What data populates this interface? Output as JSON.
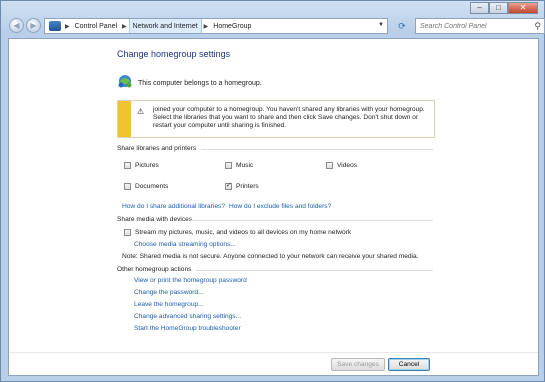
{
  "window": {
    "minimize": "–",
    "maximize": "□",
    "close": "✕"
  },
  "toolbar": {
    "breadcrumbs": [
      "Control Panel",
      "Network and Internet",
      "HomeGroup"
    ],
    "search_placeholder": "Search Control Panel",
    "back_icon": "back-arrow-icon",
    "forward_icon": "forward-arrow-icon"
  },
  "main": {
    "title": "Change homegroup settings",
    "status_text": "This computer belongs to a homegroup.",
    "warning": {
      "text": "joined your computer to a homegroup. You haven't shared any libraries with your homegroup. Select the libraries that you want to share and then click Save changes. Don't shut down or restart your computer until sharing is finished."
    },
    "share_section": {
      "heading": "Share libraries and printers",
      "items": [
        {
          "label": "Pictures",
          "checked": false
        },
        {
          "label": "Music",
          "checked": false
        },
        {
          "label": "Videos",
          "checked": false
        },
        {
          "label": "Documents",
          "checked": false
        },
        {
          "label": "Printers",
          "checked": true
        }
      ],
      "links": [
        "How do I share additional libraries?",
        "How do I exclude files and folders?"
      ]
    },
    "media_section": {
      "heading": "Share media with devices",
      "checkbox_label": "Stream my pictures, music, and videos to all devices on my home network",
      "checked": false,
      "link": "Choose media streaming options...",
      "note": "Note: Shared media is not secure. Anyone connected to your network can receive your shared media."
    },
    "other_section": {
      "heading": "Other homegroup actions",
      "links": [
        "View or print the homegroup password",
        "Change the password...",
        "Leave the homegroup...",
        "Change advanced sharing settings...",
        "Start the HomeGroup troubleshooter"
      ]
    },
    "buttons": {
      "save": "Save changes",
      "cancel": "Cancel"
    }
  },
  "colors": {
    "link": "#1a5db1",
    "title": "#1e3287",
    "warning_bar": "#f1c232"
  }
}
